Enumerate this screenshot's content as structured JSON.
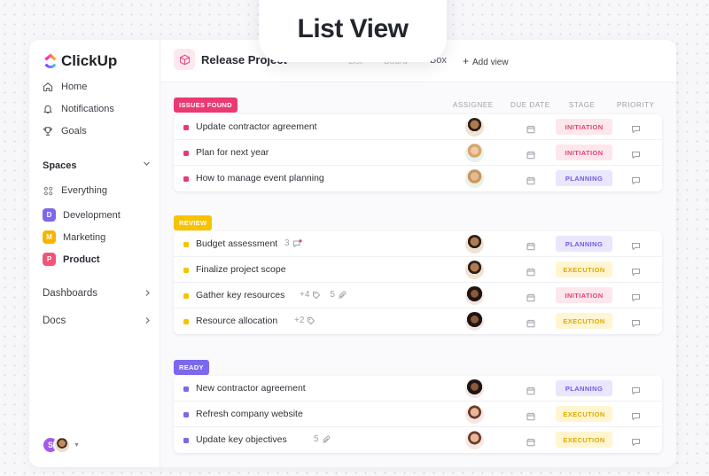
{
  "hero": {
    "title": "List View"
  },
  "app": {
    "name": "ClickUp"
  },
  "sidebar": {
    "nav": [
      {
        "label": "Home",
        "icon": "home-icon"
      },
      {
        "label": "Notifications",
        "icon": "bell-icon"
      },
      {
        "label": "Goals",
        "icon": "trophy-icon"
      }
    ],
    "spaces_heading": "Spaces",
    "everything_label": "Everything",
    "spaces": [
      {
        "letter": "D",
        "label": "Development",
        "color": "#7b68ee"
      },
      {
        "letter": "M",
        "label": "Marketing",
        "color": "#f7b500"
      },
      {
        "letter": "P",
        "label": "Product",
        "color": "#f2557a"
      }
    ],
    "dashboards": "Dashboards",
    "docs": "Docs",
    "user_initial": "S"
  },
  "topbar": {
    "project_title": "Release Project",
    "faded_tabs": [
      "List",
      "Board"
    ],
    "box_tab": "Box",
    "add_view": "Add view"
  },
  "columns": {
    "assignee": "ASSIGNEE",
    "due_date": "DUE DATE",
    "stage": "STAGE",
    "priority": "PRIORITY"
  },
  "colors": {
    "issues": "#ea3a72",
    "review": "#f7c300",
    "ready": "#7b68ee",
    "initiation_bg": "#fde6ec",
    "initiation_fg": "#e0446e",
    "planning_bg": "#e9e6fd",
    "planning_fg": "#6c5ce7",
    "execution_bg": "#fff5d1",
    "execution_fg": "#e0a800"
  },
  "groups": [
    {
      "label": "ISSUES FOUND",
      "color_key": "issues",
      "tasks": [
        {
          "name": "Update contractor agreement",
          "stage": "INITIATION",
          "avatar": "a1"
        },
        {
          "name": "Plan for next year",
          "stage": "INITIATION",
          "avatar": "a2"
        },
        {
          "name": "How to manage event planning",
          "stage": "PLANNING",
          "avatar": "a3"
        }
      ]
    },
    {
      "label": "REVIEW",
      "color_key": "review",
      "tasks": [
        {
          "name": "Budget assessment",
          "stage": "PLANNING",
          "avatar": "a1",
          "comments": "3"
        },
        {
          "name": "Finalize project scope",
          "stage": "EXECUTION",
          "avatar": "a1"
        },
        {
          "name": "Gather key resources",
          "stage": "INITIATION",
          "avatar": "a4",
          "tags": "+4",
          "attachments": "5"
        },
        {
          "name": "Resource allocation",
          "stage": "EXECUTION",
          "avatar": "a4",
          "tags": "+2"
        }
      ]
    },
    {
      "label": "READY",
      "color_key": "ready",
      "tasks": [
        {
          "name": "New contractor agreement",
          "stage": "PLANNING",
          "avatar": "a4"
        },
        {
          "name": "Refresh company website",
          "stage": "EXECUTION",
          "avatar": "a5"
        },
        {
          "name": "Update key objectives",
          "stage": "EXECUTION",
          "avatar": "a5",
          "attachments": "5"
        }
      ]
    }
  ]
}
